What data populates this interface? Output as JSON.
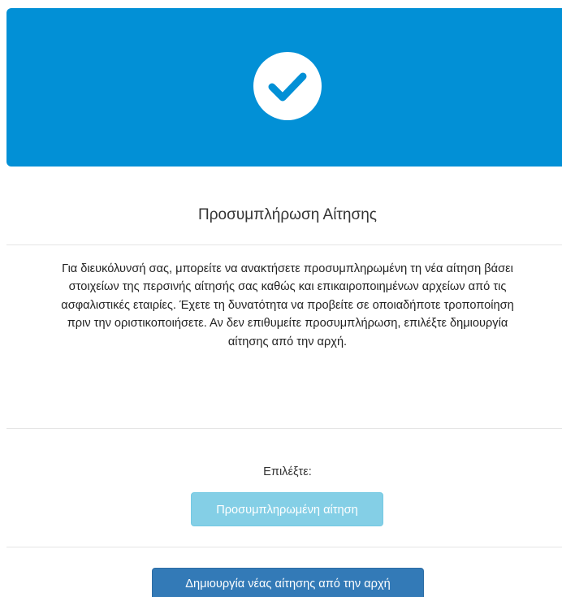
{
  "banner": {
    "icon": "check-circle-icon",
    "background_color": "#0290d6"
  },
  "page": {
    "title": "Προσυμπλήρωση Αίτησης",
    "description_lines": [
      "Για διευκόλυνσή σας, μπορείτε να ανακτήσετε προσυμπληρωμένη τη νέα αίτηση βάσει",
      "στοιχείων της περσινής αίτησής σας καθώς και επικαιροποιημένων αρχείων από τις",
      "ασφαλιστικές εταιρίες. Έχετε τη δυνατότητα να προβείτε σε οποιαδήποτε τροποποίηση",
      "πριν την οριστικοποιήσετε. Αν δεν επιθυμείτε προσυμπλήρωση, επιλέξτε δημιουργία",
      "αίτησης από την αρχή."
    ],
    "choose_label": "Επιλέξτε:"
  },
  "actions": {
    "prefilled_button": "Προσυμπληρωμένη αίτηση",
    "new_button": "Δημιουργία νέας αίτησης από την αρχή"
  },
  "colors": {
    "primary": "#337ab7",
    "info": "#5bc0de",
    "banner": "#0290d6"
  }
}
